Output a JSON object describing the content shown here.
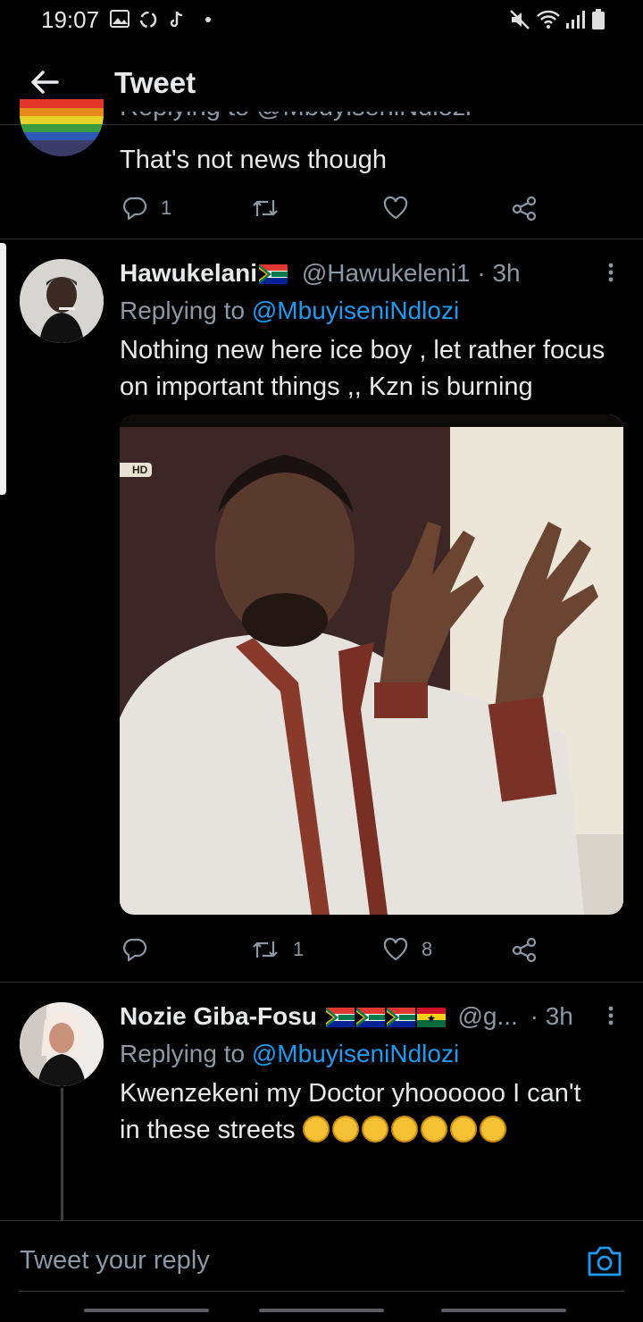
{
  "status_bar": {
    "time": "19:07"
  },
  "header": {
    "title": "Tweet"
  },
  "previous_tweet": {
    "reply_to_clipped": "Replying to @MbuyiseniNdlozi",
    "text": "That's not news though",
    "reply_count": "1",
    "retweet_count": "",
    "like_count": ""
  },
  "tweet1": {
    "name": "Hawukelani",
    "handle": "@Hawukeleni1",
    "time": "· 3h",
    "replying_prefix": "Replying to",
    "replying_to": "@MbuyiseniNdlozi",
    "text_line1": "Nothing new here ice boy , let rather focus",
    "text_line2": "on important things ,, Kzn is burning",
    "image_badge": "HD",
    "reply_count": "",
    "retweet_count": "1",
    "like_count": "8"
  },
  "tweet2": {
    "name": "Nozie Giba-Fosu",
    "handle": "@g...",
    "time": "· 3h",
    "replying_prefix": "Replying to",
    "replying_to": "@MbuyiseniNdlozi",
    "text_line1": "Kwenzekeni my Doctor yhoooooo I can't",
    "text_line2": "in these streets"
  },
  "reply_bar": {
    "placeholder": "Tweet your reply"
  },
  "colors": {
    "accent": "#1d9bf0",
    "background": "#000000",
    "muted": "#8b98a5"
  }
}
